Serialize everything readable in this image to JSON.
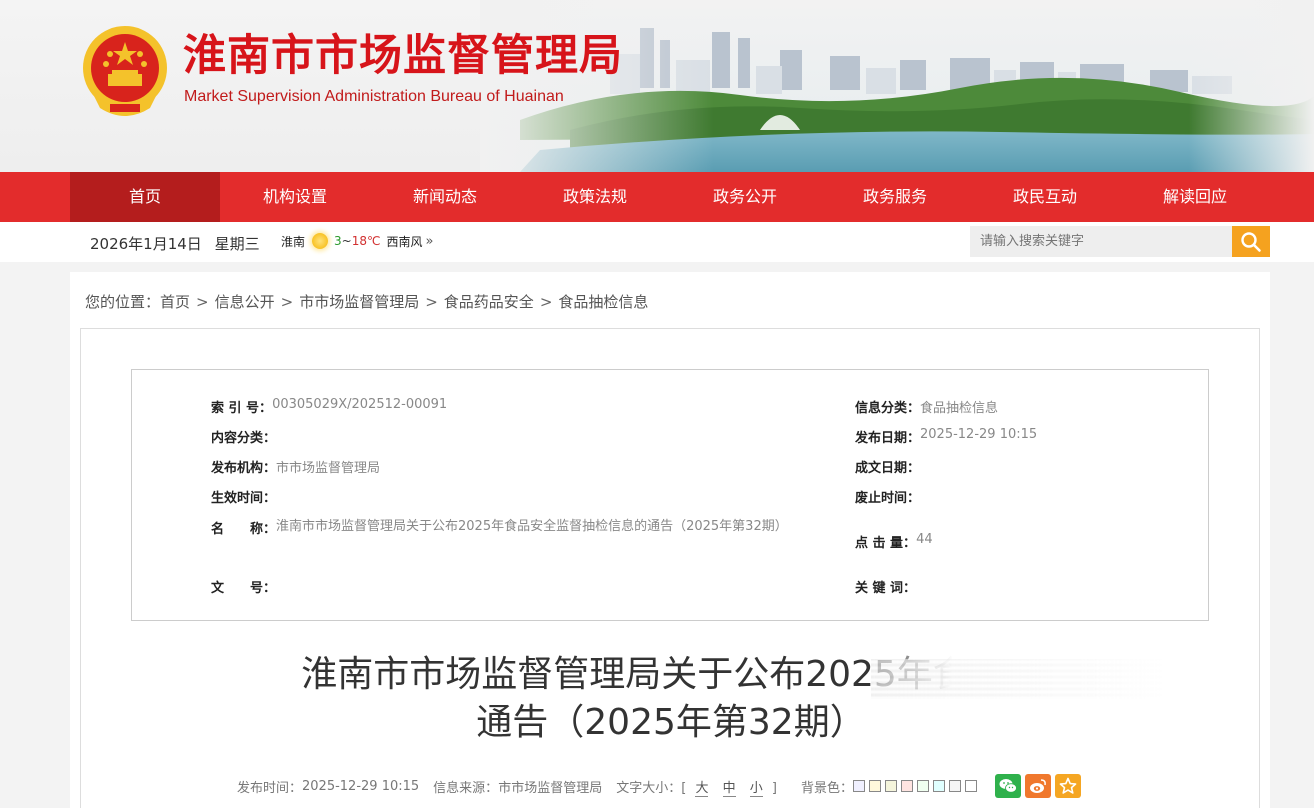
{
  "header": {
    "title": "淮南市市场监督管理局",
    "subtitle": "Market Supervision Administration Bureau of Huainan"
  },
  "nav": {
    "items": [
      "首页",
      "机构设置",
      "新闻动态",
      "政策法规",
      "政务公开",
      "政务服务",
      "政民互动",
      "解读回应"
    ],
    "active_index": 0
  },
  "infobar": {
    "date": "2026年1月14日",
    "weekday": "星期三",
    "weather": {
      "city": "淮南",
      "low": "3",
      "tilde": "~",
      "high": "18℃",
      "wind": "西南风",
      "more": "»"
    },
    "search_placeholder": "请输入搜索关键字"
  },
  "breadcrumb": {
    "prefix": "您的位置：",
    "items": [
      "首页",
      "信息公开",
      "市市场监督管理局",
      "食品药品安全",
      "食品抽检信息"
    ],
    "separator": ">"
  },
  "meta": {
    "index_no": {
      "label": "索 引 号：",
      "value": "00305029X/202512-00091"
    },
    "category": {
      "label": "信息分类：",
      "value": "食品抽检信息"
    },
    "content_type": {
      "label": "内容分类：",
      "value": ""
    },
    "publish_date": {
      "label": "发布日期：",
      "value": "2025-12-29 10:15"
    },
    "publisher": {
      "label": "发布机构：",
      "value": "市市场监督管理局"
    },
    "written_date": {
      "label": "成文日期：",
      "value": ""
    },
    "effective": {
      "label": "生效时间：",
      "value": ""
    },
    "expiry": {
      "label": "废止时间：",
      "value": ""
    },
    "name": {
      "label": "名　　称：",
      "value": "淮南市市场监督管理局关于公布2025年食品安全监督抽检信息的通告（2025年第32期）"
    },
    "clicks": {
      "label": "点 击 量：",
      "value": "44"
    },
    "doc_no": {
      "label": "文　　号：",
      "value": ""
    },
    "keywords": {
      "label": "关 键 词：",
      "value": ""
    }
  },
  "article": {
    "title_line1": "淮南市市场监督管理局关于公布2025年食品安",
    "title_line2": "通告（2025年第32期）",
    "pub_time_label": "发布时间：",
    "pub_time": "2025-12-29 10:15",
    "source_label": "信息来源：",
    "source": "市市场监督管理局",
    "font_size_label": "文字大小：",
    "font_sizes": [
      "大",
      "中",
      "小"
    ],
    "bracket_open": "[",
    "bracket_close": "]",
    "bg_color_label": "背景色：",
    "bg_colors": [
      "#f0f0ff",
      "#fff8dc",
      "#f5f5dc",
      "#ffe4e1",
      "#f0fff0",
      "#e0ffff",
      "#f5f5f5",
      "#ffffff"
    ]
  },
  "colors": {
    "nav_red": "#e32c2c",
    "nav_active": "#b41d1d",
    "search_button": "#f5a21f",
    "wechat": "#2fb14c",
    "weibo": "#f0782d",
    "favorite": "#f5a623"
  }
}
